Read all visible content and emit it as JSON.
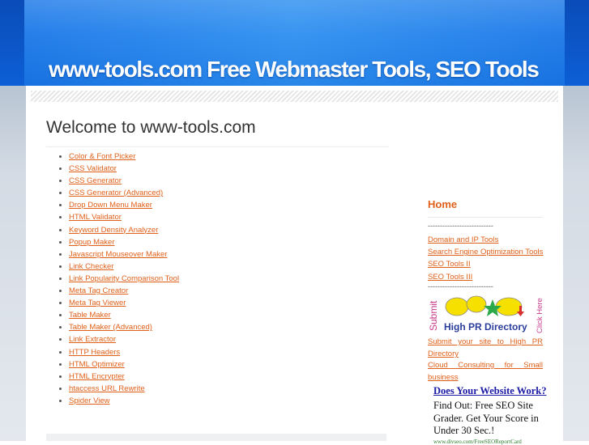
{
  "header": {
    "site_title": "www-tools.com Free Webmaster Tools, SEO Tools"
  },
  "main": {
    "title": "Welcome to www-tools.com",
    "tools": [
      "Color & Font Picker",
      "CSS Validator",
      "CSS Generator",
      "CSS Generator (Advanced)",
      "Drop Down Menu Maker",
      "HTML Validator",
      "Keyword Density Analyzer",
      "Popup Maker",
      "Javascript Mouseover Maker",
      "Link Checker",
      "Link Popularity Comparison Tool",
      "Meta Tag Creator",
      "Meta Tag Viewer",
      "Table Maker",
      "Table Maker (Advanced)",
      "Link Extractor",
      "HTTP Headers",
      "HTML Optimizer",
      "HTML Encrypter",
      "htaccess URL Rewrite",
      "Spider View"
    ]
  },
  "sidebar": {
    "home": "Home",
    "separator": "---------------------------",
    "links": [
      "Domain and IP Tools",
      "Search Engine Optimization Tools",
      "SEO Tools II",
      "SEO Tools III"
    ],
    "banner": {
      "left_text": "Submit",
      "main_text": "High PR Directory",
      "right_text": "Click Here"
    },
    "banner_link": "Submit your site to High PR Directory",
    "cloud_link": "Cloud Consulting for Small business",
    "ad": {
      "title": "Does Your Website Work?",
      "body": "Find Out: Free SEO Site Grader. Get Your Score in Under 30 Sec.!",
      "url": "www.divseo.com/FreeSEOReportCard"
    }
  },
  "colors": {
    "header_blue": "#1a78e8",
    "link_orange": "#e0601a",
    "ad_title_blue": "#1a1aa6",
    "ad_url_green": "#2a7a2a"
  }
}
